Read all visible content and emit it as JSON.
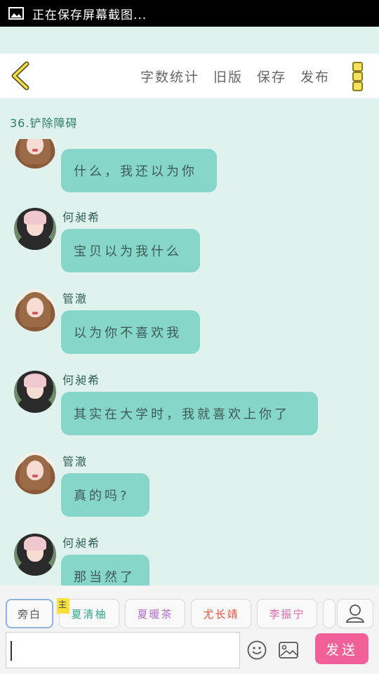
{
  "status_bar": {
    "text": "正在保存屏幕截图..."
  },
  "toolbar": {
    "actions": [
      "字数统计",
      "旧版",
      "保存",
      "发布"
    ]
  },
  "chapter": {
    "title": "36.铲除障碍"
  },
  "messages": [
    {
      "name": "",
      "text": "什么，我还以为你",
      "avatar": "girl"
    },
    {
      "name": "何昶希",
      "text": "宝贝以为我什么",
      "avatar": "boy"
    },
    {
      "name": "管澈",
      "text": "以为你不喜欢我",
      "avatar": "girl"
    },
    {
      "name": "何昶希",
      "text": "其实在大学时，我就喜欢上你了",
      "avatar": "boy"
    },
    {
      "name": "管澈",
      "text": "真的吗?",
      "avatar": "girl"
    },
    {
      "name": "何昶希",
      "text": "那当然了",
      "avatar": "boy"
    }
  ],
  "characters": [
    {
      "label": "旁白",
      "color": "#555555"
    },
    {
      "label": "夏清柚",
      "color": "#2fa88a",
      "badge": "主"
    },
    {
      "label": "夏暖茶",
      "color": "#b36bd6"
    },
    {
      "label": "尤长靖",
      "color": "#e0533a"
    },
    {
      "label": "李振宁",
      "color": "#e064a8"
    }
  ],
  "composer": {
    "send_label": "发送"
  },
  "colors": {
    "bubble": "#86d6c9",
    "background": "#dff2ee",
    "send": "#f2609a"
  }
}
